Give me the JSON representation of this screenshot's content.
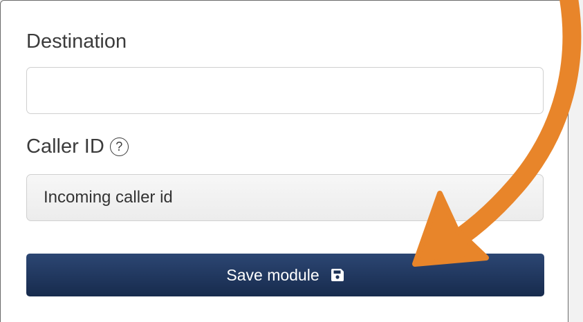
{
  "form": {
    "destination_label": "Destination",
    "destination_value": "",
    "caller_id_label": "Caller ID",
    "caller_id_help_icon": "question-circle-icon",
    "caller_id_help_glyph": "?",
    "caller_id_selected": "Incoming caller id",
    "save_button_label": "Save module",
    "save_button_icon": "floppy-disk-icon"
  },
  "colors": {
    "button_primary": "#1e3357",
    "annotation_arrow": "#e8852a",
    "panel_background": "#ffffff",
    "page_background": "#f2f2f2"
  }
}
